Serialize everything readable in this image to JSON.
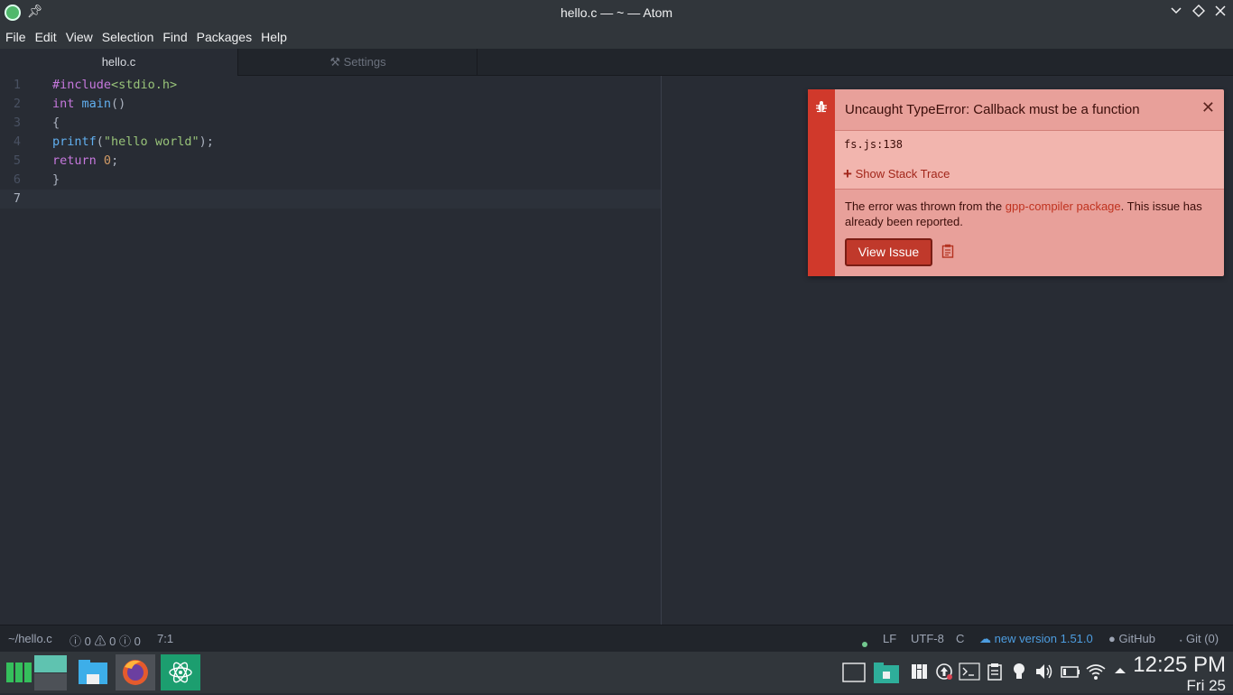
{
  "window": {
    "title": "hello.c — ~ — Atom",
    "app_icon": "atom-icon"
  },
  "menu": [
    {
      "label": "File"
    },
    {
      "label": "Edit"
    },
    {
      "label": "View"
    },
    {
      "label": "Selection"
    },
    {
      "label": "Find"
    },
    {
      "label": "Packages"
    },
    {
      "label": "Help"
    }
  ],
  "tabs": [
    {
      "label": "hello.c",
      "active": true
    },
    {
      "label": "Settings",
      "active": false,
      "icon": "tools-icon"
    }
  ],
  "editor": {
    "line_numbers": [
      "1",
      "2",
      "3",
      "4",
      "5",
      "6",
      "7"
    ],
    "cursor_line": 7
  },
  "notification": {
    "title": "Uncaught TypeError: Callback must be a function",
    "location": "fs.js:138",
    "stack_label": "Show Stack Trace",
    "desc_prefix": "The error was thrown from the ",
    "desc_link": "gpp-compiler package",
    "desc_suffix": ". This issue has already been reported.",
    "button_label": "View Issue",
    "bar_color": "#d0392b",
    "bg_color": "#e8a09a"
  },
  "status": {
    "path": "~/hello.c",
    "errors": "0",
    "warnings": "0",
    "infos": "0",
    "cursor_pos": "7:1",
    "line_ending": "LF",
    "encoding": "UTF-8",
    "grammar": "C",
    "update": "new version 1.51.0",
    "github": "GitHub",
    "git": "Git (0)"
  },
  "taskbar": {
    "time": "12:25 PM",
    "date": "Fri 25"
  }
}
